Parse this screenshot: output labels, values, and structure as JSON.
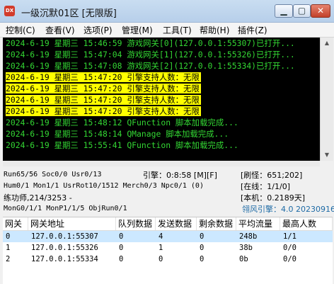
{
  "window": {
    "icon_text": "DX",
    "title": "一级沉默01区 [无限版]",
    "min_label": "▁",
    "max_label": "▢",
    "close_label": "✕"
  },
  "menu": [
    "控制(C)",
    "查看(V)",
    "选项(P)",
    "管理(M)",
    "工具(T)",
    "帮助(H)",
    "插件(Z)"
  ],
  "log": [
    {
      "text": "2024-6-19 星期三 15:46:59 游戏网关[0](127.0.0.1:55307)已打开...",
      "style": "green"
    },
    {
      "text": "2024-6-19 星期三 15:47:04 游戏网关[1](127.0.0.1:55326)已打开...",
      "style": "green"
    },
    {
      "text": "2024-6-19 星期三 15:47:08 游戏网关[2](127.0.0.1:55334)已打开...",
      "style": "green"
    },
    {
      "text": "2024-6-19 星期三 15:47:20 引擎支持人数：无限",
      "style": "yellow"
    },
    {
      "text": "2024-6-19 星期三 15:47:20 引擎支持人数：无限",
      "style": "yellow"
    },
    {
      "text": "2024-6-19 星期三 15:47:20 引擎支持人数：无限",
      "style": "yellow"
    },
    {
      "text": "2024-6-19 星期三 15:47:20 引擎支持人数：无限",
      "style": "yellow"
    },
    {
      "text": "2024-6-19 星期三 15:48:12 QFunction 脚本加载完成...",
      "style": "green"
    },
    {
      "text": "2024-6-19 星期三 15:48:14 QManage 脚本加载完成...",
      "style": "green"
    },
    {
      "text": "2024-6-19 星期三 15:55:41 QFunction 脚本加载完成...",
      "style": "green"
    }
  ],
  "status": {
    "run": "Run65/56 Soc0/0 Usr0/13",
    "engine_time": "引擎：0:8:58 [M][F]",
    "refresh": "[刷怪：651;202]",
    "hum": "Hum0/1 Mon1/1 UsrRot10/1512 Merch0/3 Npc0/1 (0)",
    "online": "[在线：1/1/0]",
    "trainer": "练功师,214/3253 -",
    "local": "[本机：0.2189天]",
    "mon": "MonG0/1/1 MonP1/1/5 ObjRun0/1",
    "engine_name": "翎风引擎：4.0 20230916"
  },
  "table": {
    "headers": [
      "网关",
      "网关地址",
      "队列数据",
      "发送数据",
      "剩余数据",
      "平均流量",
      "最高人数"
    ],
    "rows": [
      [
        "0",
        "127.0.0.1:55307",
        "0",
        "4",
        "0",
        "248b",
        "1/1"
      ],
      [
        "1",
        "127.0.0.1:55326",
        "0",
        "1",
        "0",
        "38b",
        "0/0"
      ],
      [
        "2",
        "127.0.0.1:55334",
        "0",
        "0",
        "0",
        "0b",
        "0/0"
      ]
    ]
  },
  "colors": {
    "console_bg": "#000000",
    "log_green": "#33d633",
    "log_highlight": "#ffff00",
    "selected_row": "#cce8ff",
    "engine_blue": "#1d6aa5"
  }
}
